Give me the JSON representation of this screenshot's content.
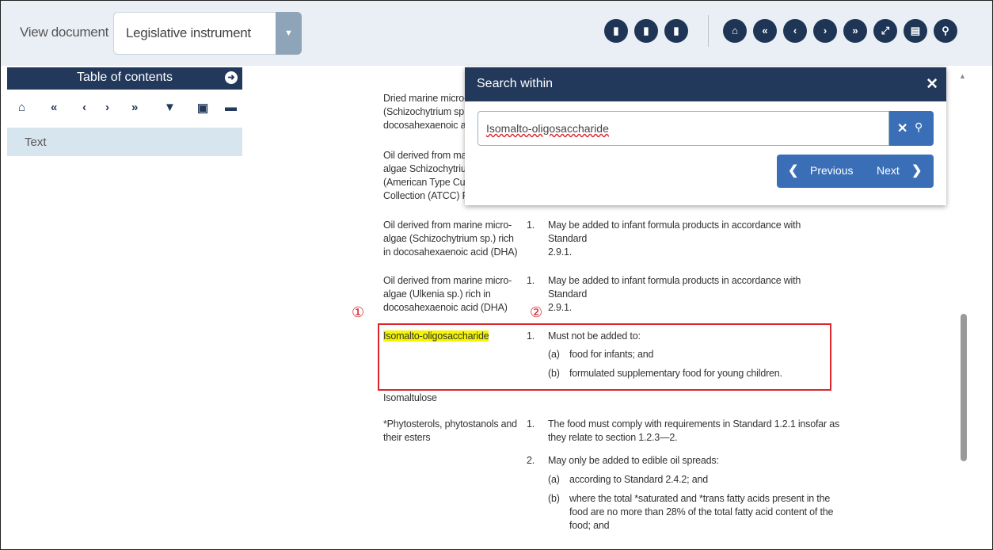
{
  "header": {
    "view_label": "View document",
    "document_type": "Legislative instrument",
    "toolbar_icons_left": [
      "document-icon",
      "document-alt-icon",
      "document-alt2-icon"
    ],
    "toolbar_icons_right": [
      "home-icon",
      "first-icon",
      "previous-icon",
      "next-icon",
      "last-icon",
      "expand-icon",
      "print-icon",
      "search-icon"
    ],
    "accent_color": "#1f3556"
  },
  "toc": {
    "title": "Table of contents",
    "tools": [
      "home",
      "first",
      "previous",
      "next",
      "last",
      "filter",
      "expand",
      "collapse"
    ],
    "items": [
      {
        "label": "Text"
      }
    ]
  },
  "content": {
    "rows": [
      {
        "term": [
          "Dried marine micro-",
          "(Schizochytrium sp.",
          "docosahexaenoic ac"
        ]
      },
      {
        "term": [
          "Oil derived from mar",
          "algae Schizochytriur",
          "(American Type Cul",
          "Collection (ATCC) P"
        ]
      },
      {
        "term": [
          "Oil derived from marine micro-",
          "algae (Schizochytrium sp.) rich",
          "in docosahexaenoic acid (DHA)"
        ],
        "num": "1.",
        "text": [
          "May be added to infant formula products in accordance with Standard",
          "2.9.1."
        ]
      },
      {
        "term": [
          "Oil derived from marine micro-",
          "algae (Ulkenia sp.) rich in",
          "docosahexaenoic acid (DHA)"
        ],
        "num": "1.",
        "text": [
          "May be added to infant formula products in accordance with Standard",
          "2.9.1."
        ]
      },
      {
        "term": [
          "Isomalto-oligosaccharide"
        ],
        "num": "1.",
        "text": [
          "Must not be added to:"
        ],
        "subs": [
          {
            "label": "(a)",
            "text": "food for infants; and"
          },
          {
            "label": "(b)",
            "text": "formulated supplementary food for young children."
          }
        ]
      },
      {
        "term": [
          "Isomaltulose"
        ]
      },
      {
        "term": [
          "*Phytosterols, phytostanols and",
          "their esters"
        ],
        "num": "1.",
        "text": [
          "The food must comply with requirements in Standard 1.2.1 insofar as",
          "they relate to section 1.2.3—2."
        ]
      },
      {
        "num": "2.",
        "text": [
          "May only be added to edible oil spreads:"
        ],
        "subs": [
          {
            "label": "(a)",
            "text": "according to Standard 2.4.2; and"
          },
          {
            "label": "(b)",
            "text": [
              "where the total *saturated and *trans fatty acids present in the",
              "food are no more than 28% of the total fatty acid content of the",
              "food; and"
            ]
          }
        ]
      }
    ],
    "markers": [
      "①",
      "②"
    ],
    "highlight_color": "#f5f500",
    "box_color": "#d9262c"
  },
  "search": {
    "title": "Search within",
    "query": "Isomalto-oligosaccharide",
    "previous_label": "Previous",
    "next_label": "Next"
  }
}
